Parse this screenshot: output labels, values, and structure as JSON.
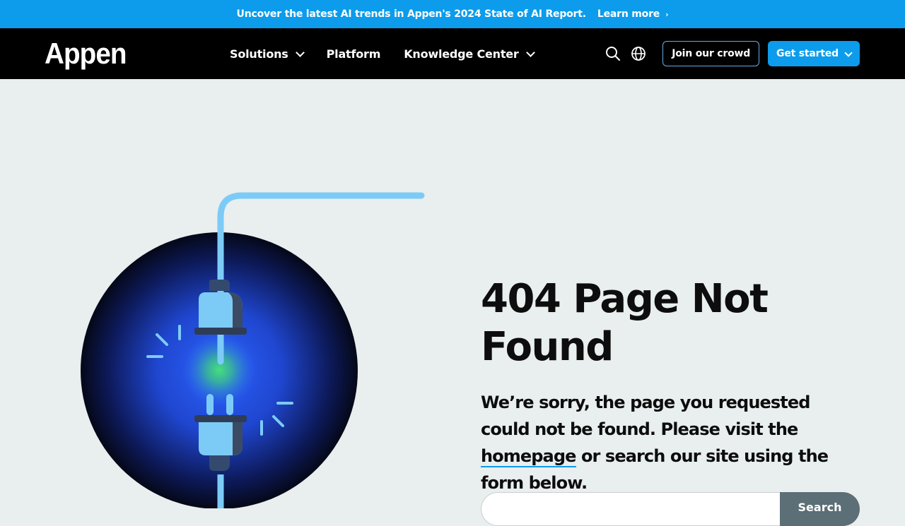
{
  "banner": {
    "text": "Uncover the latest AI trends in Appen's 2024 State of AI Report.",
    "link_label": "Learn more"
  },
  "nav": {
    "logo": "Appen",
    "items": [
      {
        "label": "Solutions",
        "has_dropdown": true
      },
      {
        "label": "Platform",
        "has_dropdown": false
      },
      {
        "label": "Knowledge Center",
        "has_dropdown": true
      }
    ],
    "icons": [
      "search-icon",
      "globe-icon"
    ],
    "join_label": "Join our crowd",
    "cta_label": "Get started"
  },
  "main": {
    "title": "404 Page Not Found",
    "desc_before": "We’re sorry, the page you requested could not be found. Please visit the ",
    "homepage_link": "homepage",
    "desc_after": " or search our site using the form below.",
    "search": {
      "placeholder": "",
      "value": "",
      "button_label": "Search"
    }
  },
  "colors": {
    "accent": "#0c9ceb",
    "nav_bg": "#000000",
    "page_bg": "#e9eeee",
    "plug": "#7ccbf7",
    "search_button": "#5c6e76"
  }
}
